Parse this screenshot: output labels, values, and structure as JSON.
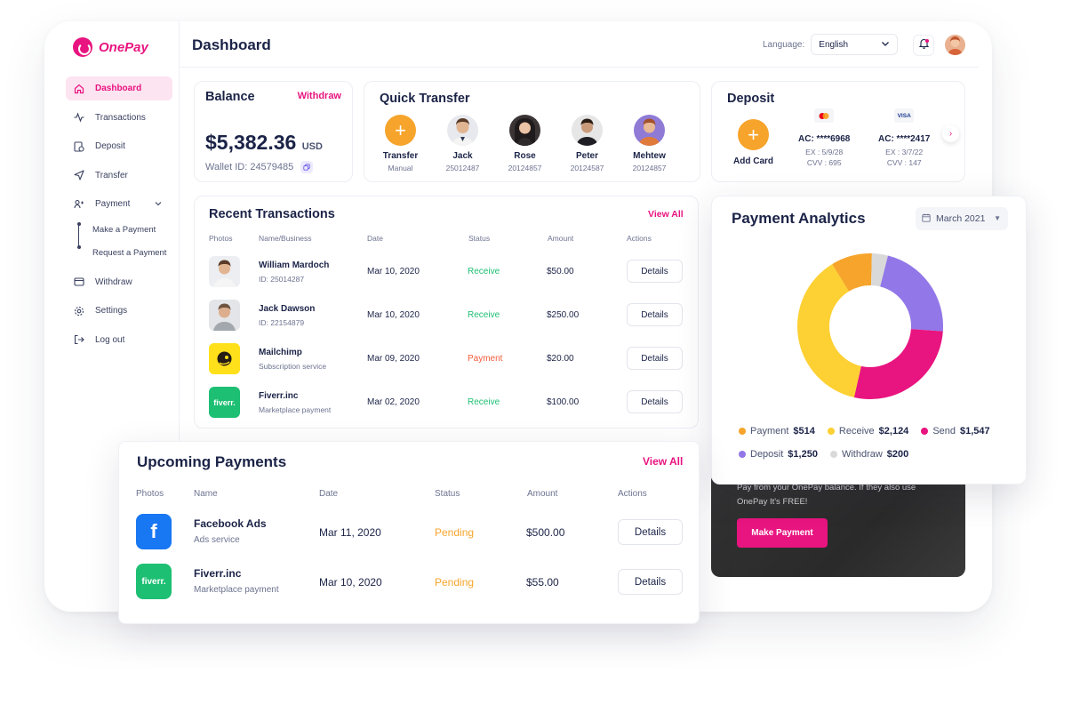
{
  "brand": {
    "name": "OnePay",
    "color": "#e8147f"
  },
  "header": {
    "title": "Dashboard",
    "language_label": "Language:",
    "language_value": "English"
  },
  "sidebar": {
    "items": [
      {
        "label": "Dashboard",
        "icon": "home-icon",
        "active": true
      },
      {
        "label": "Transactions",
        "icon": "activity-icon"
      },
      {
        "label": "Deposit",
        "icon": "deposit-icon"
      },
      {
        "label": "Transfer",
        "icon": "send-icon"
      },
      {
        "label": "Payment",
        "icon": "payment-icon",
        "expanded": true
      }
    ],
    "payment_sub": [
      "Make a Payment",
      "Request a Payment"
    ],
    "bottom_items": [
      {
        "label": "Withdraw",
        "icon": "wallet-icon"
      },
      {
        "label": "Settings",
        "icon": "gear-icon"
      },
      {
        "label": "Log out",
        "icon": "logout-icon"
      }
    ]
  },
  "balance": {
    "title": "Balance",
    "withdraw": "Withdraw",
    "amount": "$5,382.36",
    "currency": "USD",
    "wallet_id": "Wallet ID: 24579485"
  },
  "quick_transfer": {
    "title": "Quick Transfer",
    "items": [
      {
        "name": "Transfer",
        "sub": "Manual"
      },
      {
        "name": "Jack",
        "sub": "25012487"
      },
      {
        "name": "Rose",
        "sub": "20124857"
      },
      {
        "name": "Peter",
        "sub": "20124587"
      },
      {
        "name": "Mehtew",
        "sub": "20124857"
      }
    ]
  },
  "deposit": {
    "title": "Deposit",
    "add_card": "Add Card",
    "cards": [
      {
        "brand": "mastercard",
        "ac": "AC: ****6968",
        "ex": "EX : 5/9/28",
        "cvv": "CVV : 695"
      },
      {
        "brand": "VISA",
        "ac": "AC: ****2417",
        "ex": "EX : 3/7/22",
        "cvv": "CVV : 147"
      }
    ]
  },
  "recent_transactions": {
    "title": "Recent Transactions",
    "view_all": "View All",
    "columns": [
      "Photos",
      "Name/Business",
      "Date",
      "Status",
      "Amount",
      "Actions"
    ],
    "rows": [
      {
        "name": "William Mardoch",
        "sub": "ID: 25014287",
        "date": "Mar 10, 2020",
        "status": "Receive",
        "amount": "$50.00",
        "action": "Details"
      },
      {
        "name": "Jack Dawson",
        "sub": "ID: 22154879",
        "date": "Mar 10, 2020",
        "status": "Receive",
        "amount": "$250.00",
        "action": "Details"
      },
      {
        "name": "Mailchimp",
        "sub": "Subscription service",
        "date": "Mar 09, 2020",
        "status": "Payment",
        "amount": "$20.00",
        "action": "Details"
      },
      {
        "name": "Fiverr.inc",
        "sub": "Marketplace payment",
        "date": "Mar 02, 2020",
        "status": "Receive",
        "amount": "$100.00",
        "action": "Details"
      }
    ]
  },
  "promo": {
    "text": "Pay from your OnePay balance. If they also use OnePay It's FREE!",
    "button": "Make Payment"
  },
  "payment_analytics": {
    "title": "Payment Analytics",
    "period": "March 2021",
    "legend": [
      {
        "label": "Payment",
        "value": "$514",
        "color": "#f6a42b"
      },
      {
        "label": "Receive",
        "value": "$2,124",
        "color": "#fdd033"
      },
      {
        "label": "Send",
        "value": "$1,547",
        "color": "#e8147f"
      },
      {
        "label": "Deposit",
        "value": "$1,250",
        "color": "#9277e8"
      },
      {
        "label": "Withdraw",
        "value": "$200",
        "color": "#d9d9d9"
      }
    ]
  },
  "chart_data": {
    "type": "pie",
    "categories": [
      "Payment",
      "Withdraw",
      "Deposit",
      "Send",
      "Receive"
    ],
    "values": [
      514,
      200,
      1250,
      1547,
      2124
    ],
    "colors": [
      "#f6a42b",
      "#d9d9d9",
      "#9277e8",
      "#e8147f",
      "#fdd033"
    ]
  },
  "upcoming_payments": {
    "title": "Upcoming Payments",
    "view_all": "View All",
    "columns": [
      "Photos",
      "Name",
      "Date",
      "Status",
      "Amount",
      "Actions"
    ],
    "rows": [
      {
        "name": "Facebook Ads",
        "sub": "Ads service",
        "date": "Mar 11, 2020",
        "status": "Pending",
        "amount": "$500.00",
        "action": "Details",
        "logo_text": "f"
      },
      {
        "name": "Fiverr.inc",
        "sub": "Marketplace payment",
        "date": "Mar 10, 2020",
        "status": "Pending",
        "amount": "$55.00",
        "action": "Details",
        "logo_text": "fiverr."
      }
    ]
  },
  "logos": {
    "fiverr": "fiverr."
  }
}
